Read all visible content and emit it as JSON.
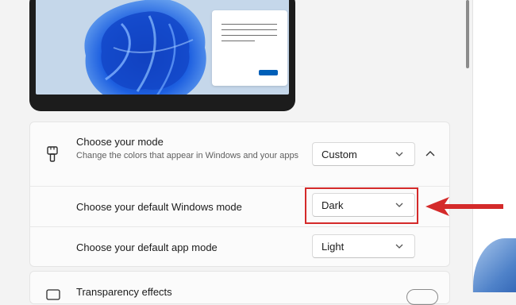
{
  "mode_card": {
    "title": "Choose your mode",
    "description": "Change the colors that appear in Windows and your apps",
    "selected": "Custom",
    "icon": "paintbrush-icon"
  },
  "windows_mode": {
    "label": "Choose your default Windows mode",
    "selected": "Dark"
  },
  "app_mode": {
    "label": "Choose your default app mode",
    "selected": "Light"
  },
  "transparency": {
    "title": "Transparency effects"
  },
  "colors": {
    "accent": "#005fb8",
    "highlight": "#d42a2a"
  }
}
